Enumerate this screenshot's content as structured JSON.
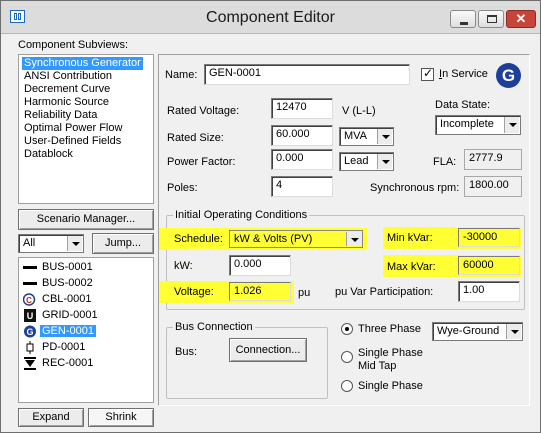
{
  "window": {
    "title": "Component Editor",
    "close_glyph": "✕"
  },
  "subviews": {
    "heading": "Component Subviews:",
    "items": [
      {
        "label": "Synchronous Generator",
        "selected": true
      },
      {
        "label": "ANSI Contribution"
      },
      {
        "label": "Decrement Curve"
      },
      {
        "label": "Harmonic Source"
      },
      {
        "label": "Reliability Data"
      },
      {
        "label": "Optimal Power Flow"
      },
      {
        "label": "User-Defined Fields"
      },
      {
        "label": "Datablock"
      }
    ]
  },
  "scenario": {
    "manager_button": "Scenario Manager...",
    "filter_value": "All",
    "jump_button": "Jump..."
  },
  "tree": {
    "items": [
      {
        "label": "BUS-0001",
        "icon": "bus-icon"
      },
      {
        "label": "BUS-0002",
        "icon": "bus-icon"
      },
      {
        "label": "CBL-0001",
        "icon": "cable-icon"
      },
      {
        "label": "GRID-0001",
        "icon": "grid-icon"
      },
      {
        "label": "GEN-0001",
        "icon": "generator-icon",
        "selected": true
      },
      {
        "label": "PD-0001",
        "icon": "protective-device-icon"
      },
      {
        "label": "REC-0001",
        "icon": "rectifier-icon"
      }
    ]
  },
  "footer": {
    "expand_button": "Expand",
    "shrink_button": "Shrink"
  },
  "form": {
    "name_label": "Name:",
    "name_value": "GEN-0001",
    "in_service_label": "In Service",
    "in_service_checked": true,
    "badge_letter": "G",
    "rated_voltage_label": "Rated Voltage:",
    "rated_voltage_value": "12470",
    "rated_voltage_unit": "V (L-L)",
    "data_state_label": "Data State:",
    "data_state_value": "Incomplete",
    "rated_size_label": "Rated Size:",
    "rated_size_value": "60.000",
    "rated_size_unit": "MVA",
    "power_factor_label": "Power Factor:",
    "power_factor_value": "0.000",
    "power_factor_type": "Lead",
    "fla_label": "FLA:",
    "fla_value": "2777.9",
    "poles_label": "Poles:",
    "poles_value": "4",
    "sync_rpm_label": "Synchronous rpm:",
    "sync_rpm_value": "1800.00"
  },
  "ioc": {
    "group_title": "Initial Operating Conditions",
    "schedule_label": "Schedule:",
    "schedule_value": "kW & Volts (PV)",
    "min_kvar_label": "Min kVar:",
    "min_kvar_value": "-30000",
    "kw_label": "kW:",
    "kw_value": "0.000",
    "max_kvar_label": "Max kVar:",
    "max_kvar_value": "60000",
    "voltage_label": "Voltage:",
    "voltage_value": "1.026",
    "voltage_unit": "pu",
    "pu_var_label": "pu Var Participation:",
    "pu_var_value": "1.00",
    "highlight_color": "#ffff33"
  },
  "bus_connection": {
    "group_title": "Bus Connection",
    "bus_label": "Bus:",
    "connection_button": "Connection..."
  },
  "phase": {
    "options": [
      {
        "label": "Three Phase",
        "selected": true
      },
      {
        "label": "Single Phase",
        "label2": "Mid Tap"
      },
      {
        "label": "Single Phase"
      }
    ],
    "connection_value": "Wye-Ground"
  }
}
